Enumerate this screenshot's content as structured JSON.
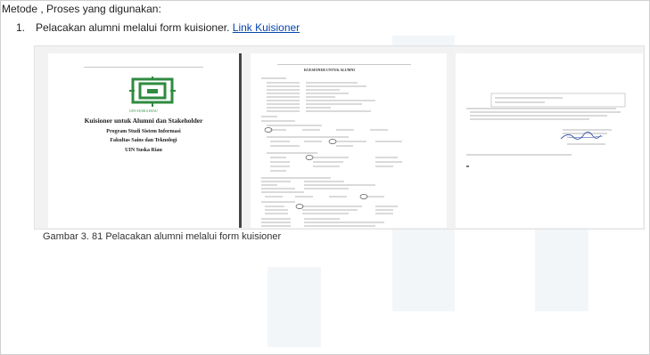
{
  "heading": "Metode , Proses yang digunakan:",
  "list_item": {
    "number": "1.",
    "text": "Pelacakan alumni melalui form kuisioner.",
    "link_text": "Link Kuisioner"
  },
  "scan": {
    "cover": {
      "institution_logo_text": "UIN SUSKA RIAU",
      "title": "Kuisioner untuk Alumni dan Stakeholder",
      "program": "Program Studi Sistem Informasi",
      "faculty": "Fakultas Sains dan Teknologi",
      "university": "UIN Suska Riau"
    },
    "form": {
      "heading": "KUESIONER UNTUK ALUMNI"
    }
  },
  "caption": "Gambar 3. 81 Pelacakan alumni melalui form kuisioner",
  "colors": {
    "link": "#0645ad",
    "logo_green": "#2e8b3f",
    "watermark": "#eef3f7"
  }
}
